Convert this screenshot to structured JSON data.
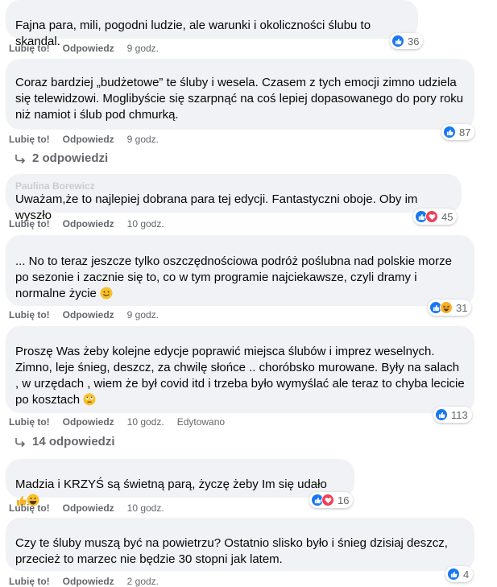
{
  "actions": {
    "like": "Lubię to!",
    "reply": "Odpowiedz",
    "edited": "Edytowano"
  },
  "comments": [
    {
      "author": "",
      "text": "Fajna para, mili, pogodni ludzie, ale warunki i okoliczności ślubu to skandal.",
      "time": "9 godz.",
      "reactions": "36",
      "reaction_icons": [
        "like-icon"
      ]
    },
    {
      "author": "",
      "text": "Coraz bardziej „budżetowe” te śluby i wesela. Czasem z tych emocji zimno udziela się telewidzowi. Moglibyście się szarpnąć na coś lepiej dopasowanego do pory roku niż namiot i ślub pod chmurką.",
      "time": "9 godz.",
      "reactions": "87",
      "reaction_icons": [
        "like-icon"
      ],
      "replies": "2 odpowiedzi"
    },
    {
      "author": "Paulina Borewicz",
      "text": "Uważam,że to najlepiej dobrana para tej edycji. Fantastyczni oboje. Oby im wyszło",
      "time": "10 godz.",
      "reactions": "45",
      "reaction_icons": [
        "like-icon",
        "love-icon"
      ]
    },
    {
      "author": "",
      "text": "... No to teraz jeszcze tylko oszczędnościowa podróż poślubna nad polskie morze po sezonie i zacznie się to, co w tym programie najciekawsze, czyli dramy i normalne życie",
      "time": "9 godz.",
      "reactions": "31",
      "reaction_icons": [
        "like-icon",
        "haha-icon"
      ],
      "emoji": "slightly-smiling-emoji"
    },
    {
      "author": "",
      "text": "Proszę Was żeby kolejne edycje poprawić miejsca ślubów i imprez weselnych. Zimno, leje śnieg, deszcz, za chwilę słońce .. choróbsko murowane. Były na salach , w urzędach , wiem że był covid itd i trzeba było wymyślać ale teraz to chyba lecicie po kosztach",
      "time": "10 godz.",
      "reactions": "113",
      "reaction_icons": [
        "like-icon"
      ],
      "emoji": "eye-roll-emoji",
      "replies": "14 odpowiedzi"
    },
    {
      "author": "",
      "text": "Madzia i KRZYŚ są świetną parą, życzę żeby Im się udało",
      "time": "10 godz.",
      "reactions": "16",
      "reaction_icons": [
        "like-icon",
        "love-icon"
      ],
      "emoji": "thumbs-up-grin-emoji"
    },
    {
      "author": "",
      "text": "Czy te śluby muszą być na powietrzu? Ostatnio slisko było i śnieg dzisiaj deszcz, przecież to marzec nie będzie 30 stopni jak latem.",
      "time": "2 godz.",
      "reactions": "4",
      "reaction_icons": [
        "like-icon"
      ]
    }
  ]
}
